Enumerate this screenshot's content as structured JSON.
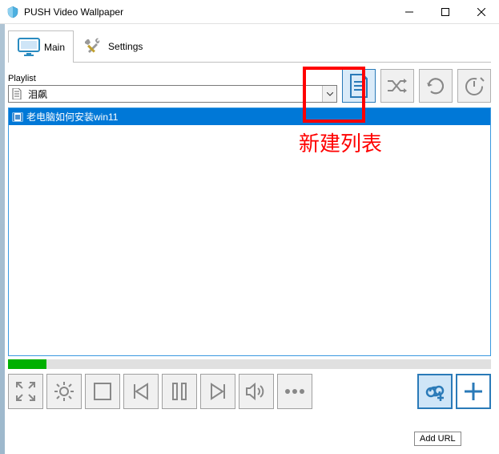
{
  "window": {
    "title": "PUSH Video Wallpaper"
  },
  "tabs": {
    "main": "Main",
    "settings": "Settings"
  },
  "playlist": {
    "label": "Playlist",
    "selected": "泪飙"
  },
  "list": {
    "items": [
      {
        "title": "老电脑如何安装win11"
      }
    ]
  },
  "annotation": {
    "text": "新建列表"
  },
  "tooltip": {
    "text": "Add URL"
  },
  "progress": {
    "percent": 8
  }
}
